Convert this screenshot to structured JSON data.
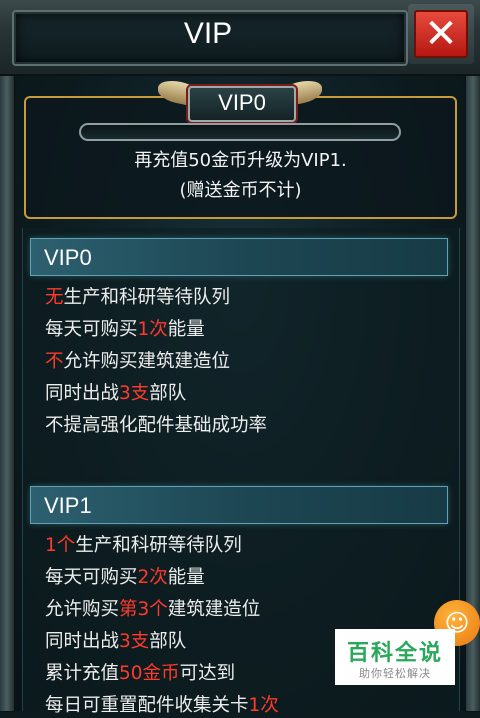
{
  "window": {
    "title": "VIP",
    "close_icon": "close-x-icon"
  },
  "current_badge": {
    "level": "VIP0"
  },
  "upgrade": {
    "progress": 0,
    "line1": "再充值50金币升级为VIP1.",
    "line2": "(赠送金币不计)"
  },
  "tiers": [
    {
      "name": "VIP0",
      "perks": [
        [
          {
            "t": "无",
            "hl": true
          },
          {
            "t": "生产和科研等待队列",
            "hl": false
          }
        ],
        [
          {
            "t": "每天可购买",
            "hl": false
          },
          {
            "t": "1次",
            "hl": true
          },
          {
            "t": "能量",
            "hl": false
          }
        ],
        [
          {
            "t": "不",
            "hl": true
          },
          {
            "t": "允许购买建筑建造位",
            "hl": false
          }
        ],
        [
          {
            "t": "同时出战",
            "hl": false
          },
          {
            "t": "3支",
            "hl": true
          },
          {
            "t": "部队",
            "hl": false
          }
        ],
        [
          {
            "t": "不提高强化配件基础成功率",
            "hl": false
          }
        ]
      ]
    },
    {
      "name": "VIP1",
      "perks": [
        [
          {
            "t": "1个",
            "hl": true
          },
          {
            "t": "生产和科研等待队列",
            "hl": false
          }
        ],
        [
          {
            "t": "每天可购买",
            "hl": false
          },
          {
            "t": "2次",
            "hl": true
          },
          {
            "t": "能量",
            "hl": false
          }
        ],
        [
          {
            "t": "允许购买",
            "hl": false
          },
          {
            "t": "第3个",
            "hl": true
          },
          {
            "t": "建筑建造位",
            "hl": false
          }
        ],
        [
          {
            "t": "同时出战",
            "hl": false
          },
          {
            "t": "3支",
            "hl": true
          },
          {
            "t": "部队",
            "hl": false
          }
        ],
        [
          {
            "t": "累计充值",
            "hl": false
          },
          {
            "t": "50金币",
            "hl": true
          },
          {
            "t": "可达到",
            "hl": false
          }
        ],
        [
          {
            "t": "每日可重置配件收集关卡",
            "hl": false
          },
          {
            "t": "1次",
            "hl": true
          }
        ]
      ]
    }
  ],
  "colors": {
    "highlight": "#ff3a2c",
    "panel_border": "#c89b3a",
    "tier_header": "#2d6070"
  },
  "watermark": {
    "main": "百科全说",
    "sub": "助你轻松解决"
  }
}
